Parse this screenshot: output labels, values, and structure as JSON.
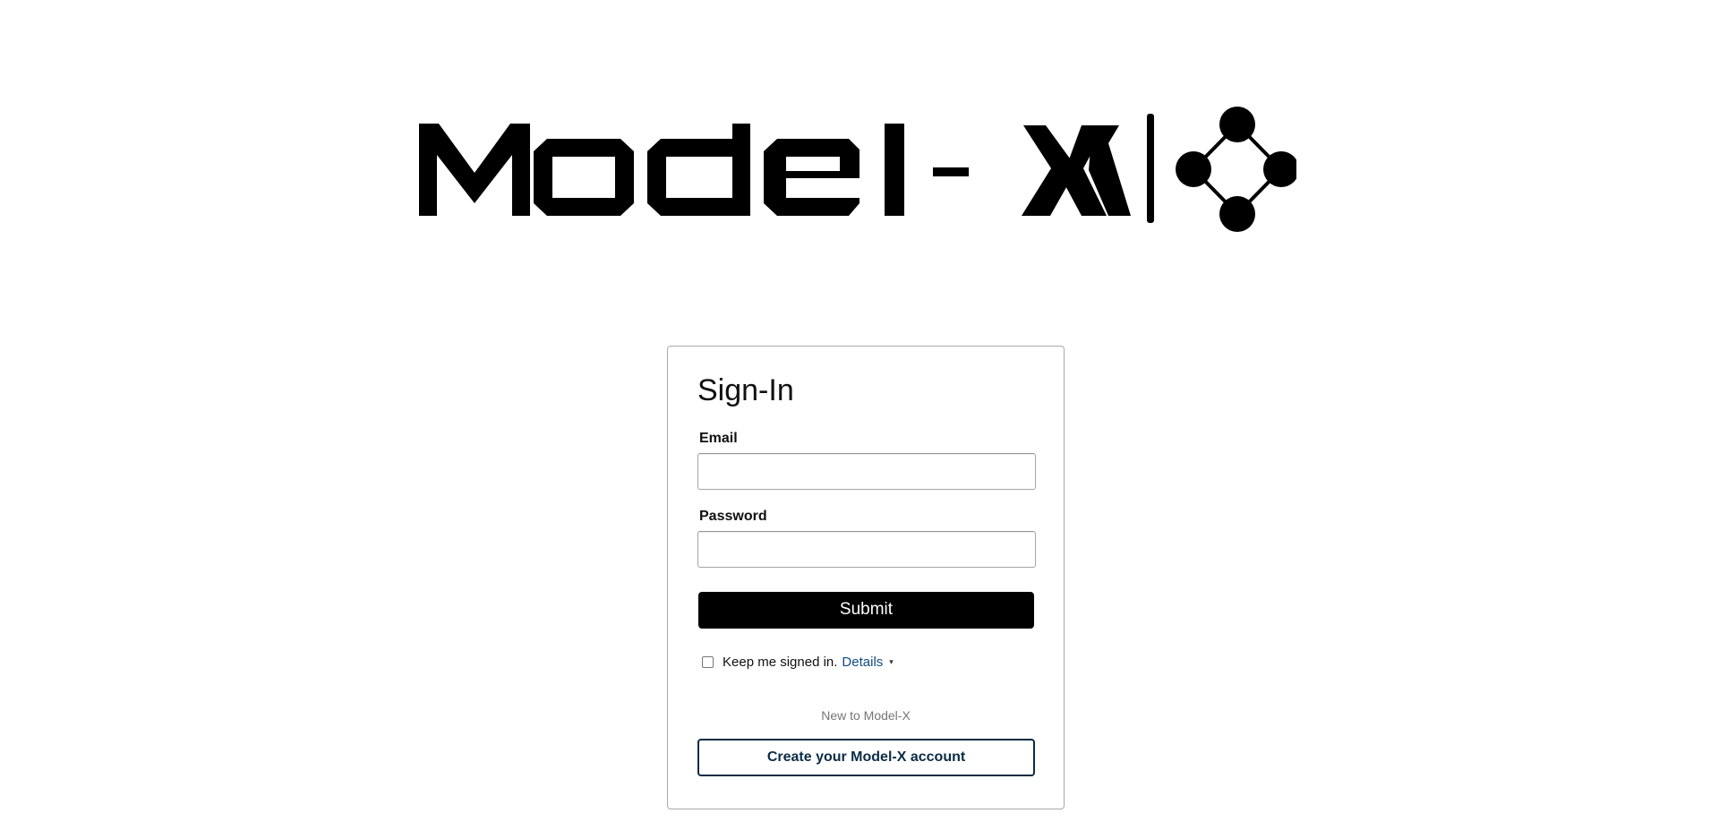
{
  "logo": {
    "wordmark": "Model-X",
    "icon": "network-graph-icon"
  },
  "signin": {
    "title": "Sign-In",
    "email_label": "Email",
    "email_value": "",
    "email_placeholder": "",
    "password_label": "Password",
    "password_value": "",
    "password_placeholder": "",
    "submit_label": "Submit",
    "remember_label": "Keep me signed in.",
    "remember_checked": false,
    "details_label": "Details",
    "details_icon": "caret-down-icon",
    "new_prompt": "New to Model-X",
    "create_label": "Create your Model-X account"
  },
  "colors": {
    "primary_button": "#000000",
    "link": "#0f4c81",
    "create_border": "#0b2c45",
    "muted_text": "#767676",
    "card_border": "#a9a9a9"
  }
}
